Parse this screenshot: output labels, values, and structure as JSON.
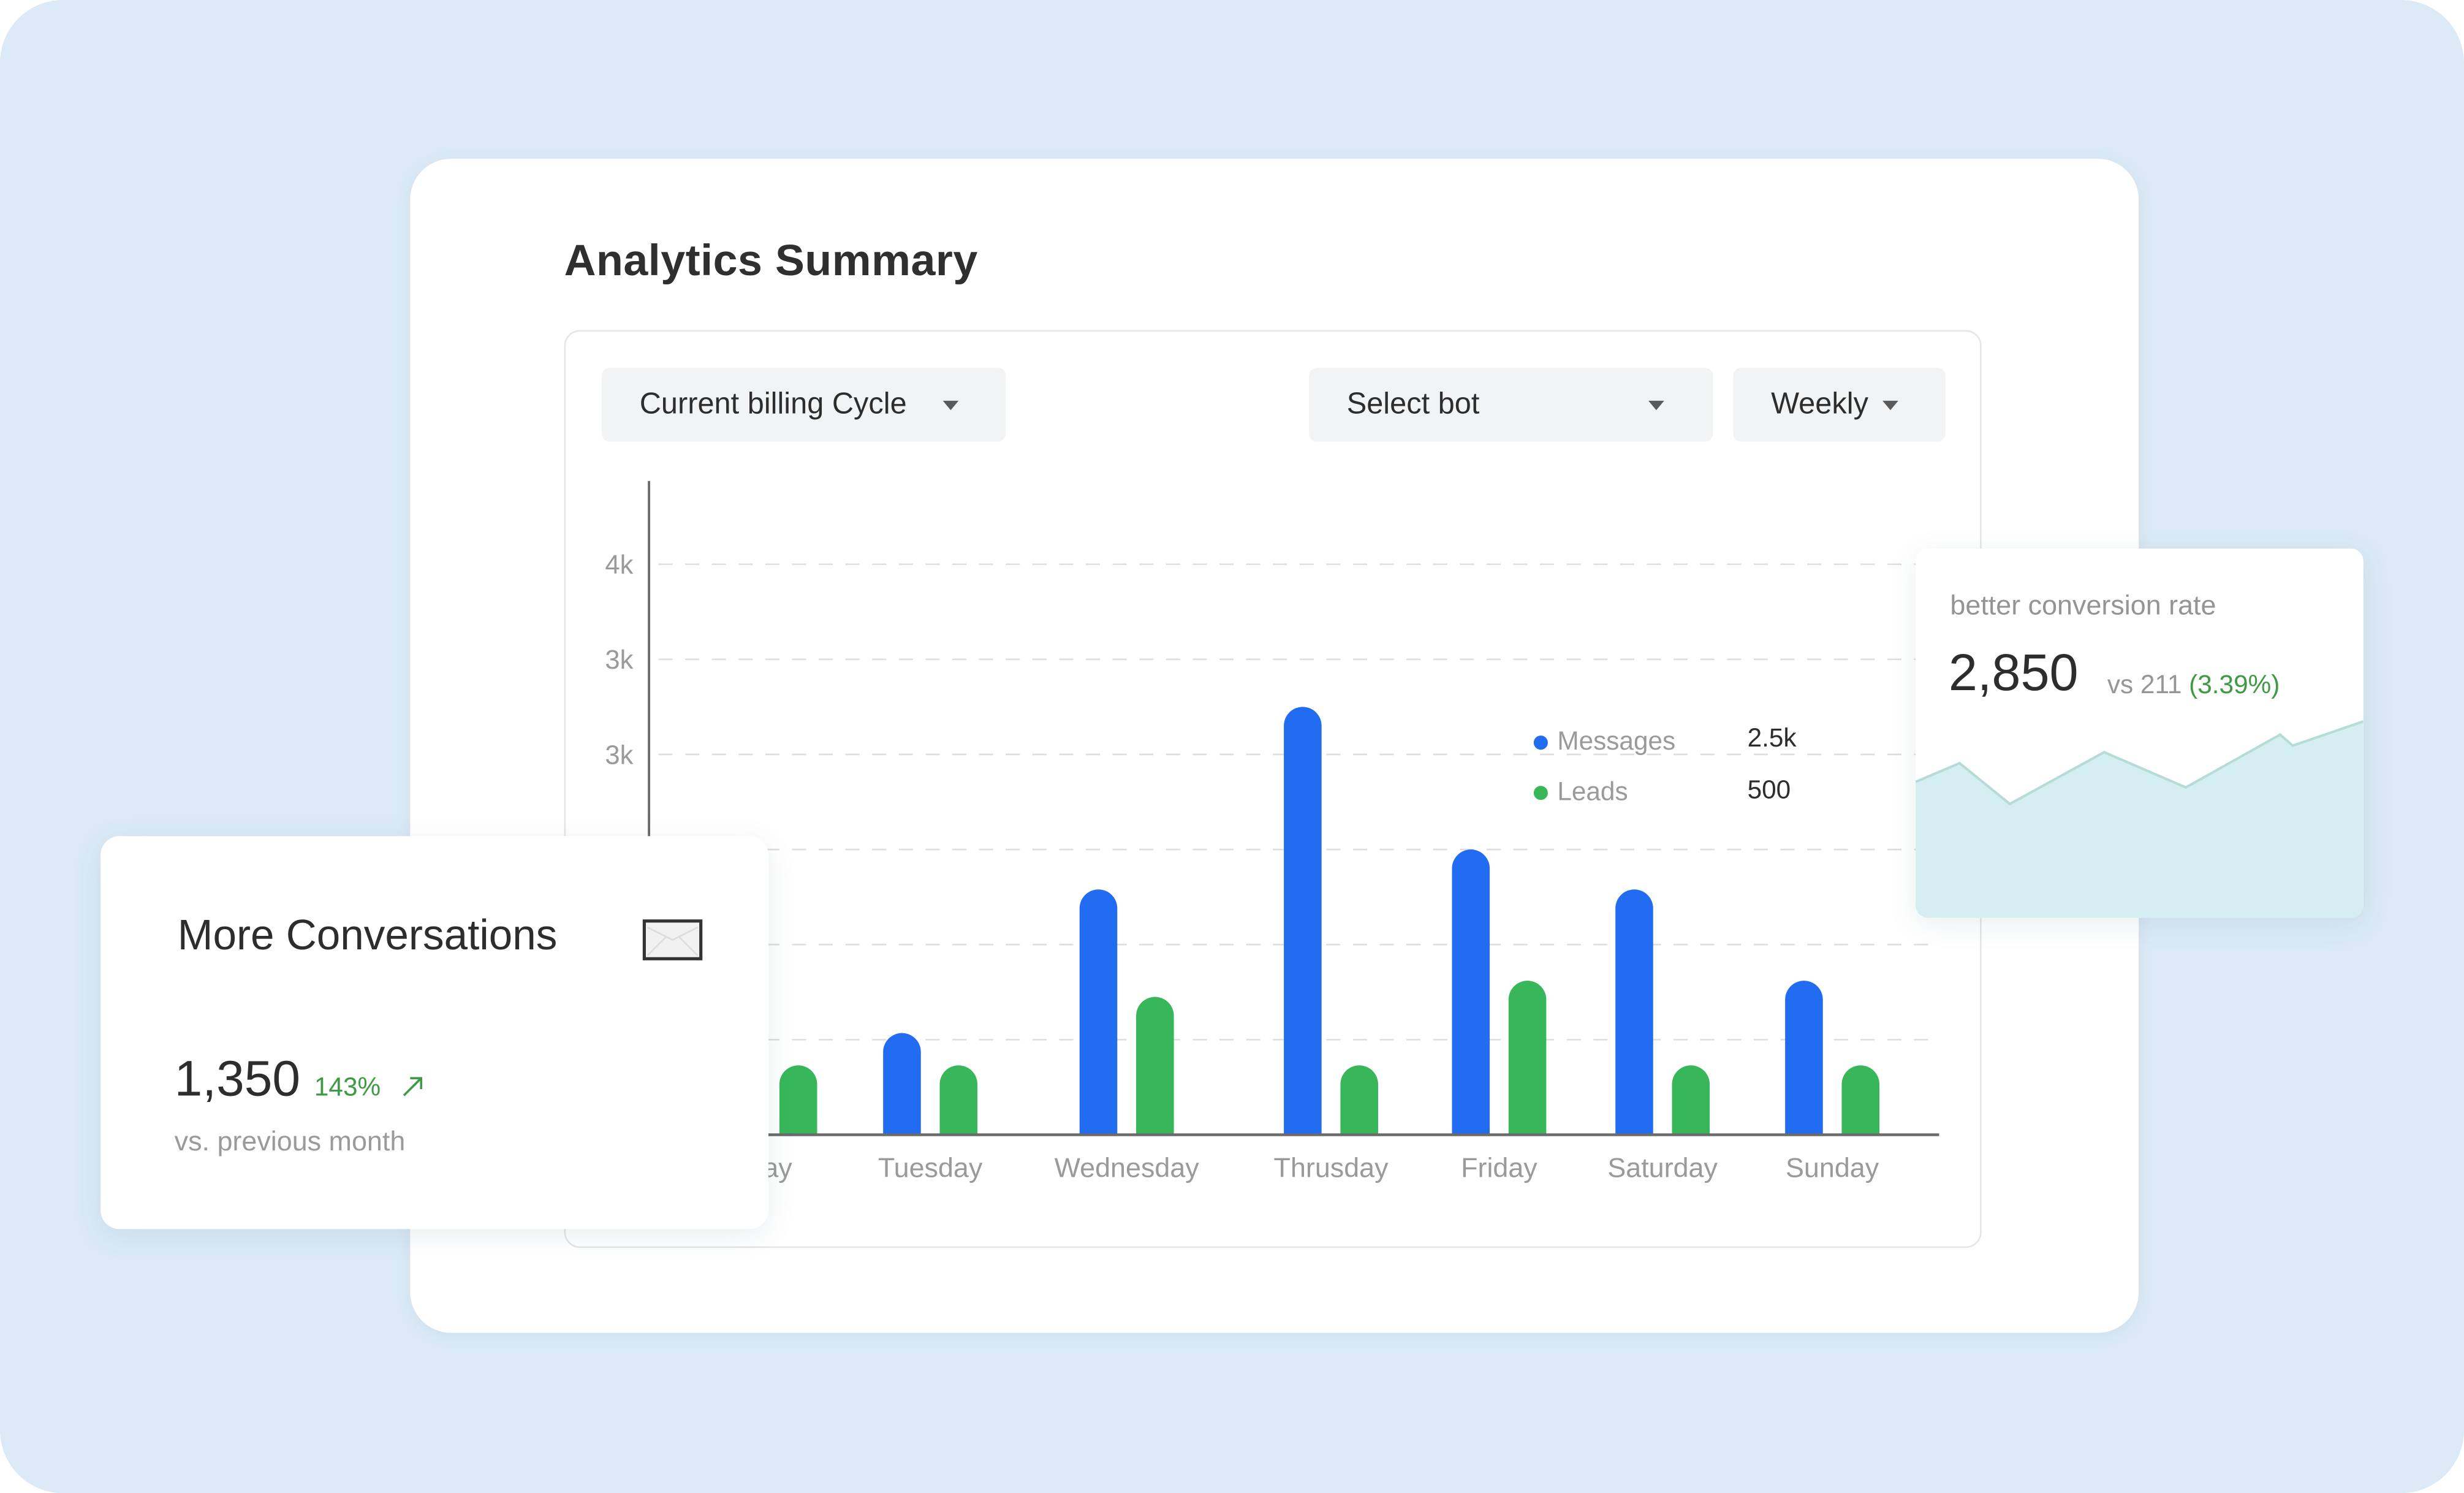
{
  "title": "Analytics Summary",
  "filters": {
    "billing_cycle": "Current billing Cycle",
    "bot": "Select bot",
    "period": "Weekly"
  },
  "colors": {
    "messages": "#216cf0",
    "leads": "#37b75a",
    "positive": "#3f9a45",
    "background": "#dbeaf6",
    "sparkline_fill": "#d5eef1",
    "sparkline_stroke": "#b6dcd8"
  },
  "chart_data": {
    "type": "bar",
    "title": "Analytics Summary",
    "xlabel": "",
    "ylabel": "",
    "categories": [
      "Monday",
      "Tuesday",
      "Wednesday",
      "Thrusday",
      "Friday",
      "Saturday",
      "Sunday"
    ],
    "visible_category_labels": [
      "day",
      "Tuesday",
      "Wednesday",
      "Thrusday",
      "Friday",
      "Saturday",
      "Sunday"
    ],
    "y_ticks": [
      {
        "value": 6,
        "label": "4k"
      },
      {
        "value": 5,
        "label": "3k"
      },
      {
        "value": 4,
        "label": "3k"
      },
      {
        "value": 3,
        "label": ""
      },
      {
        "value": 2,
        "label": ""
      },
      {
        "value": 1,
        "label": ""
      }
    ],
    "ylim": [
      0,
      6.9
    ],
    "grid": true,
    "series": [
      {
        "name": "Messages",
        "values": [
          null,
          1.07,
          2.58,
          4.5,
          3.0,
          2.58,
          1.62
        ]
      },
      {
        "name": "Leads",
        "values": [
          0.73,
          0.73,
          1.45,
          0.73,
          1.62,
          0.73,
          0.73
        ]
      }
    ],
    "legend": {
      "placement": "inside-top-right",
      "entries": [
        {
          "name": "Messages",
          "value": "2.5k"
        },
        {
          "name": "Leads",
          "value": "500"
        }
      ]
    }
  },
  "more_conversations": {
    "title": "More Conversations",
    "icon": "envelope-icon",
    "value": "1,350",
    "change": "143%",
    "change_icon": "arrow-up-right-icon",
    "subtitle": "vs. previous month"
  },
  "conversion": {
    "label": "better conversion rate",
    "value": "2,850",
    "vs_text": "vs 211",
    "change": "(3.39%)",
    "sparkline": [
      0.45,
      0.62,
      0.25,
      0.72,
      0.4,
      0.88,
      0.78,
      1.0
    ]
  }
}
